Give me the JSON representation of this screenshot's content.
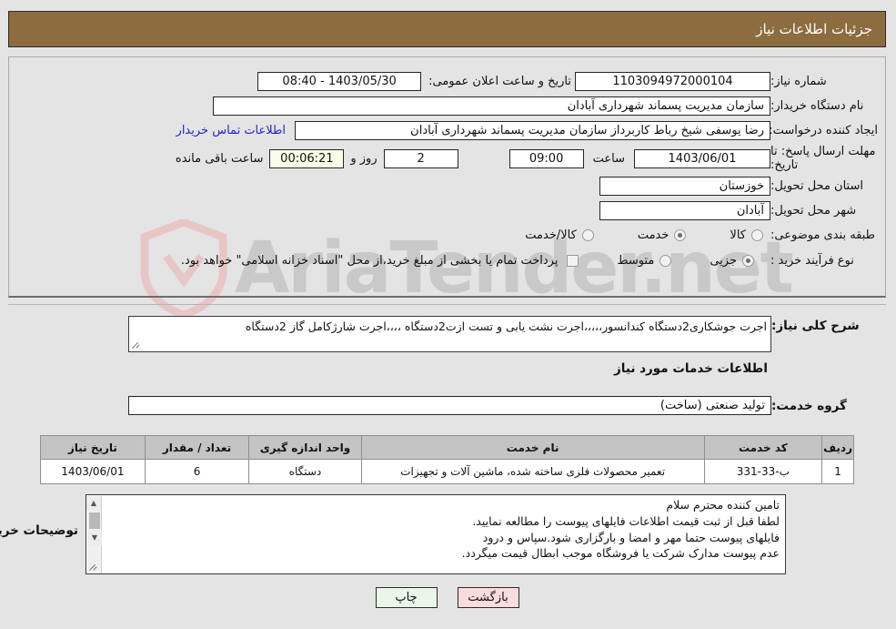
{
  "header": {
    "title": "جزئیات اطلاعات نیاز"
  },
  "form": {
    "need_number_label": "شماره نیاز:",
    "need_number_value": "1103094972000104",
    "announce_datetime_label": "تاریخ و ساعت اعلان عمومی:",
    "announce_datetime_value": "1403/05/30 - 08:40",
    "buyer_org_label": "نام دستگاه خریدار:",
    "buyer_org_value": "سازمان مدیریت پسماند شهرداری آبادان",
    "creator_label": "ایجاد کننده درخواست:",
    "creator_value": "رضا یوسفی شیخ رباط کاربرداز سازمان مدیریت پسماند شهرداری آبادان",
    "buyer_contact_link": "اطلاعات تماس خریدار",
    "deadline_label": "مهلت ارسال پاسخ: تا تاریخ:",
    "deadline_date": "1403/06/01",
    "time_label": "ساعت",
    "deadline_time": "09:00",
    "days_value": "2",
    "days_label": "روز و",
    "remaining_value": "00:06:21",
    "remaining_label": "ساعت باقی مانده",
    "province_label": "استان محل تحویل:",
    "province_value": "خوزستان",
    "city_label": "شهر محل تحویل:",
    "city_value": "آبادان",
    "category_label": "طبقه بندی موضوعی:",
    "category_options": [
      {
        "label": "کالا",
        "selected": false
      },
      {
        "label": "خدمت",
        "selected": true
      },
      {
        "label": "کالا/خدمت",
        "selected": false
      }
    ],
    "process_label": "نوع فرآیند خرید :",
    "process_options": [
      {
        "label": "جزیی",
        "selected": true
      },
      {
        "label": "متوسط",
        "selected": false
      }
    ],
    "treasury_checkbox_checked": false,
    "treasury_text": "پرداخت تمام یا بخشی از مبلغ خرید،از محل \"اسناد خزانه اسلامی\" خواهد بود."
  },
  "description": {
    "need_summary_label": "شرح کلی نیاز:",
    "need_summary_value": "اجرت جوشکاری2دستگاه کندانسور،،،،،اجرت نشت یابی و تست ازت2دستگاه ،،،،اجرت شارژکامل گاز 2دستگاه",
    "services_section_title": "اطلاعات خدمات مورد نیاز",
    "service_group_label": "گروه خدمت:",
    "service_group_value": "تولید صنعتی (ساخت)"
  },
  "table": {
    "headers": [
      "ردیف",
      "کد خدمت",
      "نام خدمت",
      "واحد اندازه گیری",
      "تعداد / مقدار",
      "تاریخ نیاز"
    ],
    "rows": [
      {
        "index": "1",
        "code": "ب-33-331",
        "name": "تعمیر محصولات فلزی ساخته شده، ماشین آلات و تجهیزات",
        "unit": "دستگاه",
        "quantity": "6",
        "need_date": "1403/06/01"
      }
    ]
  },
  "comments": {
    "label": "توضیحات خریدار:",
    "lines": [
      "تامین کننده محترم سلام",
      "لطفا قبل از ثبت قیمت اطلاعات فایلهای پیوست را مطالعه نمایید.",
      "فایلهای پیوست حتما مهر و امضا و بارگزاری شود.سپاس و درود",
      "عدم پیوست مدارک شرکت یا فروشگاه موجب ابطال قیمت میگردد."
    ],
    "scroll_up_icon": "▲",
    "scroll_down_icon": "▼"
  },
  "footer": {
    "print_label": "چاپ",
    "back_label": "بازگشت"
  },
  "watermark": {
    "text": "AriaTender.net",
    "shield_color": "#e9c6c6",
    "text_color": "#c9c9c9"
  },
  "colors": {
    "header_bg": "#8d6c3f",
    "page_bg": "#e4e4e4",
    "link": "#2323d0",
    "print_btn": "#e9f7e9",
    "back_btn": "#fbdcdc",
    "highlight_field": "#fbfbe6"
  }
}
